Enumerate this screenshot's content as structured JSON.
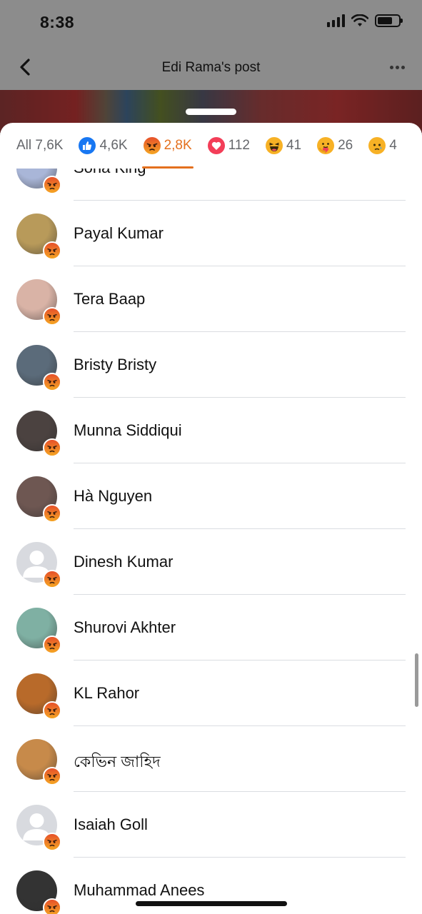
{
  "status_bar": {
    "time": "8:38"
  },
  "header": {
    "title": "Edi Rama's post"
  },
  "tabs": [
    {
      "label": "All 7,6K",
      "icon": null,
      "active": false
    },
    {
      "label": "4,6K",
      "icon": "like-icon",
      "active": false
    },
    {
      "label": "2,8K",
      "icon": "angry-icon",
      "active": true
    },
    {
      "label": "112",
      "icon": "love-icon",
      "active": false
    },
    {
      "label": "41",
      "icon": "haha-icon",
      "active": false
    },
    {
      "label": "26",
      "icon": "care-icon",
      "active": false
    },
    {
      "label": "4",
      "icon": "sad-icon",
      "active": false
    }
  ],
  "colors": {
    "accent": "#e4701e",
    "angry": "#f0742a",
    "like": "#1877f2",
    "love": "#f33e58",
    "text_secondary": "#65676b"
  },
  "people": [
    {
      "name": "Sona King",
      "avatar": "#a9b6d8"
    },
    {
      "name": "Payal Kumar",
      "avatar": "#b89a5a"
    },
    {
      "name": "Tera Baap",
      "avatar": "#d9b3a6"
    },
    {
      "name": "Bristy Bristy",
      "avatar": "#5b6b7a"
    },
    {
      "name": "Munna Siddiqui",
      "avatar": "#4b4240"
    },
    {
      "name": "Hà Nguyen",
      "avatar": "#6e5752"
    },
    {
      "name": "Dinesh Kumar",
      "avatar": "default"
    },
    {
      "name": "Shurovi Akhter",
      "avatar": "#7fb0a3"
    },
    {
      "name": "KL Rahor",
      "avatar": "#b86a2a"
    },
    {
      "name": "কেভিন জাহিদ",
      "avatar": "#c78a4a"
    },
    {
      "name": "Isaiah Goll",
      "avatar": "default"
    },
    {
      "name": "Muhammad Anees",
      "avatar": "#333333"
    }
  ]
}
